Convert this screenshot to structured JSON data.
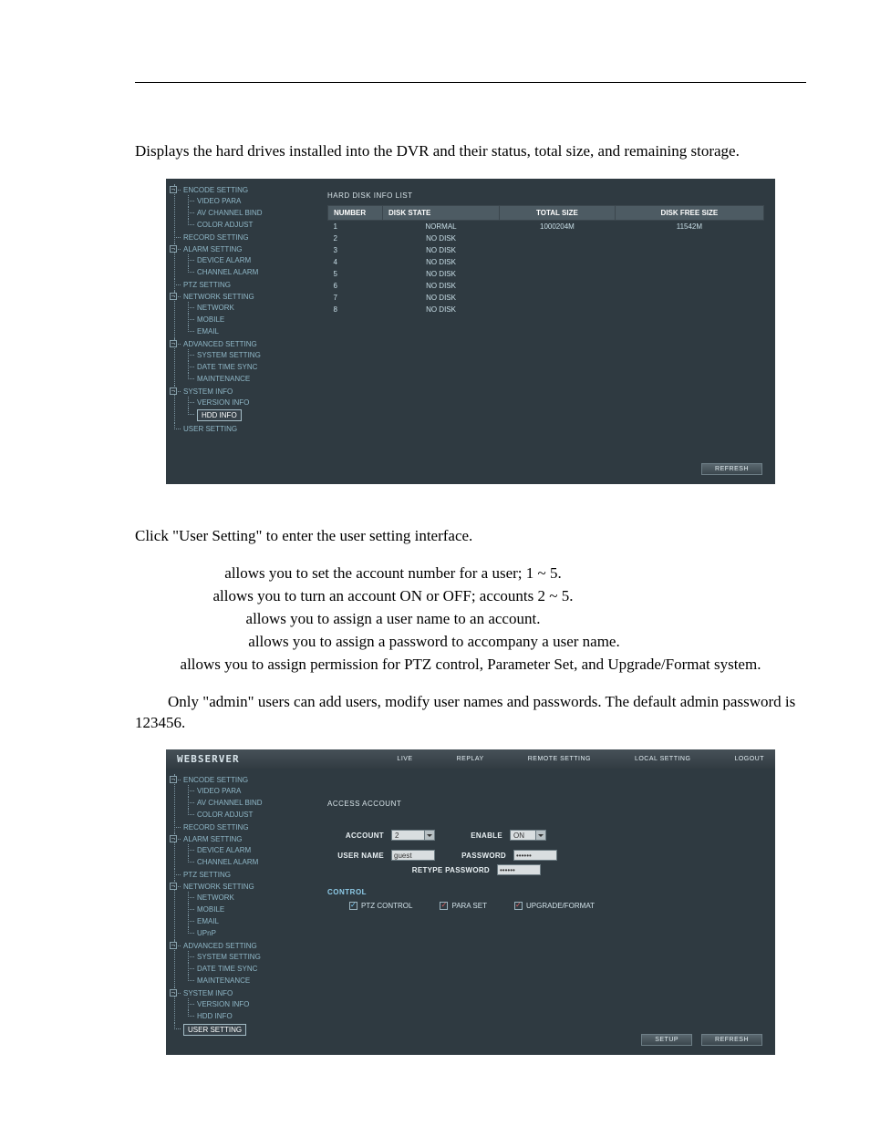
{
  "text": {
    "intro": "Displays the hard drives installed into the DVR and their status, total size, and remaining storage.",
    "user_setting_click": "Click \"User Setting\" to enter the user setting interface.",
    "account_line": "allows you to set the account number for a user; 1 ~ 5.",
    "enable_line": "allows you to turn an account ON or OFF; accounts 2 ~ 5.",
    "username_line": "allows you to assign a user name to an account.",
    "password_line": "allows you to assign a password to accompany a user name.",
    "control_line": "allows you to assign permission for PTZ control, Parameter Set, and Upgrade/Format system.",
    "note_line": "Only \"admin\" users can add users, modify user names and passwords. The default admin password is 123456."
  },
  "sidebar": {
    "groups": [
      {
        "label": "ENCODE SETTING",
        "children": [
          "VIDEO PARA",
          "AV CHANNEL BIND",
          "COLOR ADJUST"
        ]
      },
      {
        "label": "RECORD SETTING",
        "children": []
      },
      {
        "label": "ALARM SETTING",
        "children": [
          "DEVICE ALARM",
          "CHANNEL ALARM"
        ]
      },
      {
        "label": "PTZ SETTING",
        "children": []
      },
      {
        "label": "NETWORK SETTING",
        "children": [
          "NETWORK",
          "MOBILE",
          "EMAIL"
        ]
      },
      {
        "label": "ADVANCED SETTING",
        "children": [
          "SYSTEM SETTING",
          "DATE TIME SYNC",
          "MAINTENANCE"
        ]
      },
      {
        "label": "SYSTEM INFO",
        "children": [
          "VERSION INFO",
          "HDD INFO"
        ]
      },
      {
        "label": "USER SETTING",
        "children": []
      }
    ],
    "selected_shot1": "HDD INFO",
    "selected_shot2": "USER SETTING",
    "network_extra_shot2": "UPnP"
  },
  "topbar": {
    "brand": "WEBSERVER",
    "tabs": [
      "LIVE",
      "REPLAY",
      "REMOTE SETTING",
      "LOCAL SETTING",
      "LOGOUT"
    ]
  },
  "hdd": {
    "title": "HARD DISK INFO LIST",
    "headers": [
      "NUMBER",
      "DISK STATE",
      "TOTAL SIZE",
      "DISK FREE SIZE"
    ],
    "rows": [
      {
        "n": "1",
        "state": "NORMAL",
        "total": "1000204M",
        "free": "11542M"
      },
      {
        "n": "2",
        "state": "NO DISK",
        "total": "",
        "free": ""
      },
      {
        "n": "3",
        "state": "NO DISK",
        "total": "",
        "free": ""
      },
      {
        "n": "4",
        "state": "NO DISK",
        "total": "",
        "free": ""
      },
      {
        "n": "5",
        "state": "NO DISK",
        "total": "",
        "free": ""
      },
      {
        "n": "6",
        "state": "NO DISK",
        "total": "",
        "free": ""
      },
      {
        "n": "7",
        "state": "NO DISK",
        "total": "",
        "free": ""
      },
      {
        "n": "8",
        "state": "NO DISK",
        "total": "",
        "free": ""
      }
    ],
    "buttons": {
      "refresh": "REFRESH"
    }
  },
  "user": {
    "title": "ACCESS ACCOUNT",
    "labels": {
      "account": "ACCOUNT",
      "enable": "ENABLE",
      "username": "USER NAME",
      "password": "PASSWORD",
      "retype": "RETYPE PASSWORD",
      "control": "CONTROL",
      "ptz": "PTZ CONTROL",
      "para": "PARA SET",
      "upg": "UPGRADE/FORMAT"
    },
    "values": {
      "account": "2",
      "enable": "ON",
      "username": "guest",
      "password": "••••••",
      "retype": "••••••"
    },
    "checks": {
      "ptz": true,
      "para": false,
      "upg": false
    },
    "buttons": {
      "setup": "SETUP",
      "refresh": "REFRESH"
    }
  }
}
